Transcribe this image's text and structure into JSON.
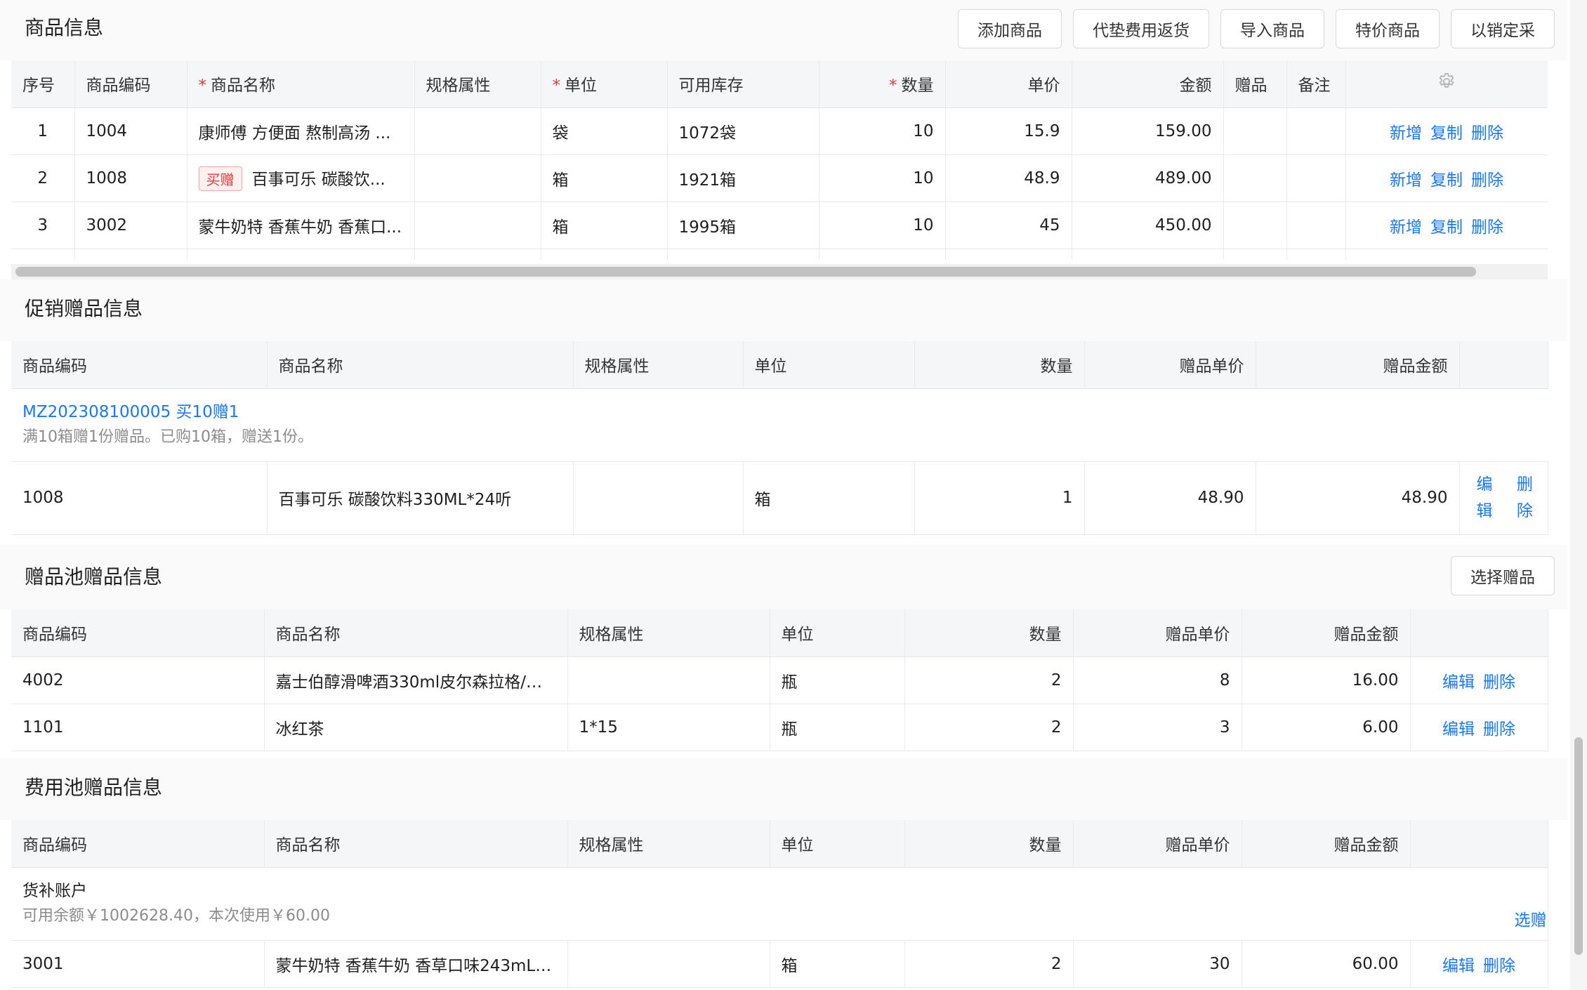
{
  "goods": {
    "title": "商品信息",
    "buttons": [
      "添加商品",
      "代垫费用返货",
      "导入商品",
      "特价商品",
      "以销定采"
    ],
    "headers": [
      "序号",
      "商品编码",
      "商品名称",
      "规格属性",
      "单位",
      "可用库存",
      "数量",
      "单价",
      "金额",
      "赠品",
      "备注"
    ],
    "ops": [
      "新增",
      "复制",
      "删除"
    ],
    "rows": [
      {
        "idx": "1",
        "code": "1004",
        "tag": "",
        "name": "康师傅 方便面 熬制高汤 ...",
        "spec": "",
        "unit": "袋",
        "stock": "1072袋",
        "qty": "10",
        "price": "15.9",
        "amount": "159.00"
      },
      {
        "idx": "2",
        "code": "1008",
        "tag": "买赠",
        "name": "百事可乐 碳酸饮...",
        "spec": "",
        "unit": "箱",
        "stock": "1921箱",
        "qty": "10",
        "price": "48.9",
        "amount": "489.00"
      },
      {
        "idx": "3",
        "code": "3002",
        "tag": "",
        "name": "蒙牛奶特 香蕉牛奶 香蕉口...",
        "spec": "",
        "unit": "箱",
        "stock": "1995箱",
        "qty": "10",
        "price": "45",
        "amount": "450.00"
      }
    ]
  },
  "promo": {
    "title": "促销赠品信息",
    "headers": [
      "商品编码",
      "商品名称",
      "规格属性",
      "单位",
      "数量",
      "赠品单价",
      "赠品金额"
    ],
    "group_title": "MZ202308100005 买10赠1",
    "group_sub": "满10箱赠1份赠品。已购10箱，赠送1份。",
    "row": {
      "code": "1008",
      "name": "百事可乐 碳酸饮料330ML*24听",
      "spec": "",
      "unit": "箱",
      "qty": "1",
      "price": "48.90",
      "amount": "48.90"
    },
    "edit": "编辑",
    "del": "删除"
  },
  "pool": {
    "title": "赠品池赠品信息",
    "button": "选择赠品",
    "headers": [
      "商品编码",
      "商品名称",
      "规格属性",
      "单位",
      "数量",
      "赠品单价",
      "赠品金额"
    ],
    "edit": "编辑",
    "del": "删除",
    "rows": [
      {
        "code": "4002",
        "name": "嘉士伯醇滑啤酒330ml皮尔森拉格/特...",
        "spec": "",
        "unit": "瓶",
        "qty": "2",
        "price": "8",
        "amount": "16.00"
      },
      {
        "code": "1101",
        "name": "冰红茶",
        "spec": "1*15",
        "unit": "瓶",
        "qty": "2",
        "price": "3",
        "amount": "6.00"
      }
    ]
  },
  "fee": {
    "title": "费用池赠品信息",
    "headers": [
      "商品编码",
      "商品名称",
      "规格属性",
      "单位",
      "数量",
      "赠品单价",
      "赠品金额"
    ],
    "group_title": "货补账户",
    "group_sub": "可用余额￥1002628.40，本次使用￥60.00",
    "select_link": "选赠品",
    "edit": "编辑",
    "del": "删除",
    "row": {
      "code": "3001",
      "name": "蒙牛奶特 香蕉牛奶 香草口味243mL*...",
      "spec": "",
      "unit": "箱",
      "qty": "2",
      "price": "30",
      "amount": "60.00"
    }
  },
  "colors": {
    "accent": "#1677ff",
    "required": "#e53935",
    "header_bg": "#f5f6f7"
  }
}
